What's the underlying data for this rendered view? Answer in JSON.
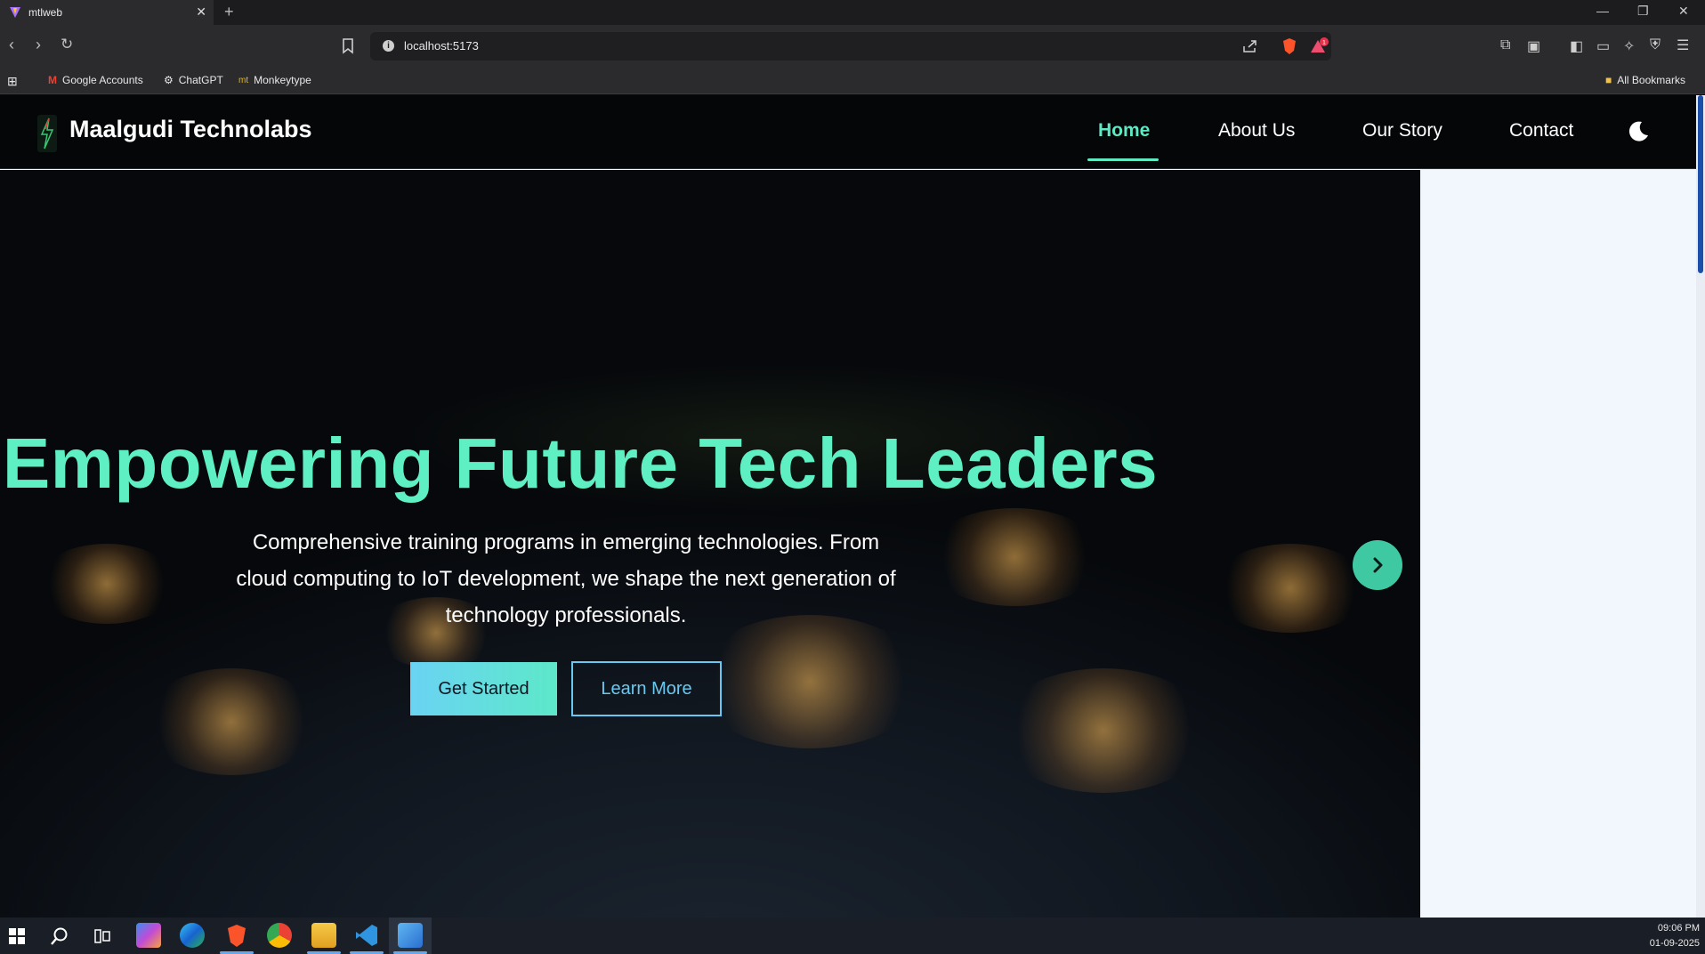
{
  "browser": {
    "tab_title": "mtlweb",
    "tab_close": "✕",
    "new_tab": "+",
    "url": "localhost:5173",
    "bookmarks": [
      {
        "label": "Google Accounts"
      },
      {
        "label": "ChatGPT"
      },
      {
        "label": "Monkeytype"
      }
    ],
    "all_bookmarks": "All Bookmarks"
  },
  "site": {
    "brand": "Maalgudi Technolabs",
    "nav": [
      {
        "label": "Home",
        "active": true
      },
      {
        "label": "About Us"
      },
      {
        "label": "Our Story"
      },
      {
        "label": "Contact"
      }
    ],
    "accent_color": "#5ee9c4"
  },
  "hero": {
    "title": "Empowering Future Tech Leaders",
    "subtitle_lines": [
      "Comprehensive training programs in emerging technologies. From",
      "cloud computing to IoT development, we shape the next generation of",
      "technology professionals."
    ],
    "primary_button": "Get Started",
    "secondary_button": "Learn More"
  },
  "taskbar": {
    "time": "09:06 PM",
    "date": "01-09-2025"
  }
}
